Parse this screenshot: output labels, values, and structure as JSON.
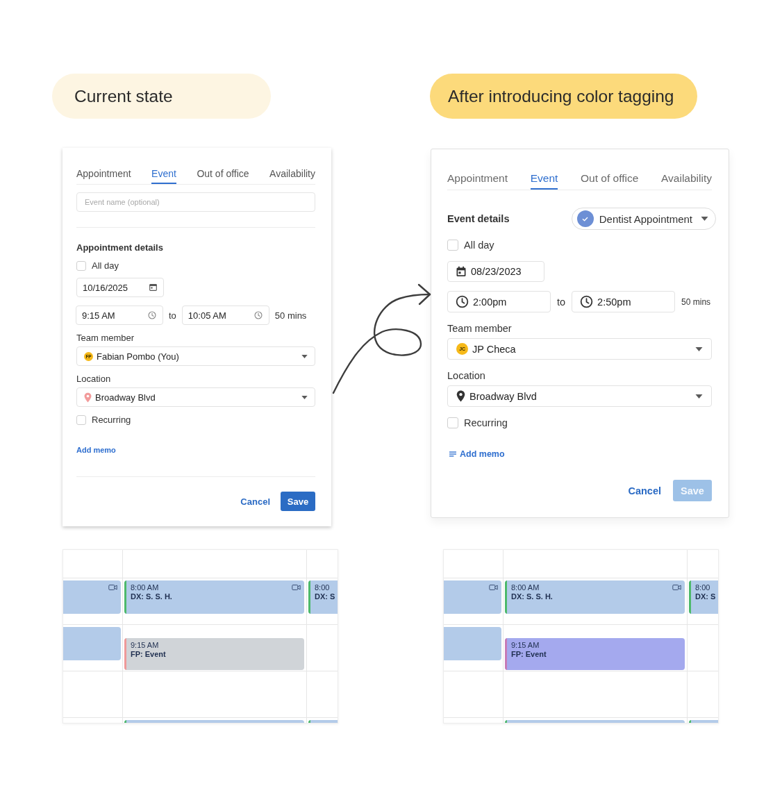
{
  "panels": [
    {
      "kind": "before",
      "heading": "Current state",
      "form": {
        "tabs": [
          {
            "label": "Appointment",
            "selected": false
          },
          {
            "label": "Event",
            "selected": true
          },
          {
            "label": "Out of office",
            "selected": false
          },
          {
            "label": "Availability",
            "selected": false
          }
        ],
        "event_name": {
          "placeholder": "Event name (optional)"
        },
        "section_title": "Appointment details",
        "all_day": {
          "label": "All day",
          "checked": false
        },
        "date": "10/16/2025",
        "times": {
          "start": "9:15 AM",
          "separator": "to",
          "end": "10:05 AM",
          "duration": "50 mins"
        },
        "team_member": {
          "label": "Team member",
          "initials": "FP",
          "value": "Fabian Pombo (You)"
        },
        "location": {
          "label": "Location",
          "value": "Broadway Blvd"
        },
        "recurring": {
          "label": "Recurring",
          "checked": false
        },
        "add_memo": "Add memo",
        "cancel": "Cancel",
        "save": {
          "label": "Save",
          "disabled": false
        }
      },
      "calendar": {
        "rows": [
          {
            "cells": [
              {
                "kind": "event",
                "color": "#b3cbe9",
                "video": true
              },
              {
                "kind": "event",
                "time": "8:00 AM",
                "title": "DX: S. S. H.",
                "stripe": {
                  "color": "#4db96b"
                },
                "color": "#b3cbe9",
                "video": true
              },
              {
                "kind": "event",
                "time": "8:00",
                "title": "DX: S",
                "stripe": {
                  "color": "#4db96b"
                },
                "color": "#b3cbe9",
                "video": false
              }
            ]
          },
          {
            "cells": [
              {
                "kind": "event",
                "color": "#b3cbe9",
                "video": false
              },
              {
                "kind": "late_event",
                "time": "9:15 AM",
                "title": "FP: Event",
                "stripe": {
                  "color": "#ef9999"
                },
                "color": "#d0d4d8",
                "video": false
              },
              {
                "kind": "empty"
              }
            ]
          },
          {
            "cells": [
              {
                "kind": "empty"
              },
              {
                "kind": "empty"
              },
              {
                "kind": "empty"
              }
            ]
          },
          {
            "cells": [
              {
                "kind": "empty"
              },
              {
                "kind": "sliver",
                "stripe": {
                  "color": "#4db96b"
                },
                "color": "#b3cbe9"
              },
              {
                "kind": "sliver",
                "stripe": {
                  "color": "#4db96b"
                },
                "color": "#b3cbe9"
              }
            ]
          }
        ]
      }
    },
    {
      "kind": "after",
      "heading": "After introducing color tagging",
      "form": {
        "tabs": [
          {
            "label": "Appointment",
            "selected": false
          },
          {
            "label": "Event",
            "selected": true
          },
          {
            "label": "Out of office",
            "selected": false
          },
          {
            "label": "Availability",
            "selected": false
          }
        ],
        "section_title": "Event details",
        "tag": {
          "label": "Dentist Appointment",
          "color": "#6d8fd5"
        },
        "all_day": {
          "label": "All day",
          "checked": false
        },
        "date": "08/23/2023",
        "times": {
          "start": "2:00pm",
          "separator": "to",
          "end": "2:50pm",
          "duration": "50 mins"
        },
        "team_member": {
          "label": "Team member",
          "initials": "JC",
          "value": "JP Checa"
        },
        "location": {
          "label": "Location",
          "value": "Broadway Blvd"
        },
        "recurring": {
          "label": "Recurring",
          "checked": false
        },
        "add_memo": "Add memo",
        "cancel": "Cancel",
        "save": {
          "label": "Save",
          "disabled": true
        }
      },
      "calendar": {
        "rows": [
          {
            "cells": [
              {
                "kind": "event",
                "color": "#b3cbe9",
                "video": true
              },
              {
                "kind": "event",
                "time": "8:00 AM",
                "title": "DX: S. S. H.",
                "stripe": {
                  "color": "#4db96b"
                },
                "color": "#b3cbe9",
                "video": true
              },
              {
                "kind": "event",
                "time": "8:00",
                "title": "DX: S",
                "stripe": {
                  "color": "#4db96b"
                },
                "color": "#b3cbe9",
                "video": false
              }
            ]
          },
          {
            "cells": [
              {
                "kind": "event",
                "color": "#b3cbe9",
                "video": false
              },
              {
                "kind": "late_event",
                "time": "9:15 AM",
                "title": "FP: Event",
                "stripe": {
                  "color": "#c77bb7"
                },
                "color": "#a4a9ee",
                "video": false
              },
              {
                "kind": "empty"
              }
            ]
          },
          {
            "cells": [
              {
                "kind": "empty"
              },
              {
                "kind": "empty"
              },
              {
                "kind": "empty"
              }
            ]
          },
          {
            "cells": [
              {
                "kind": "empty"
              },
              {
                "kind": "sliver",
                "stripe": {
                  "color": "#4db96b"
                },
                "color": "#b3cbe9"
              },
              {
                "kind": "sliver",
                "stripe": {
                  "color": "#4db96b"
                },
                "color": "#b3cbe9"
              }
            ]
          }
        ]
      }
    }
  ]
}
